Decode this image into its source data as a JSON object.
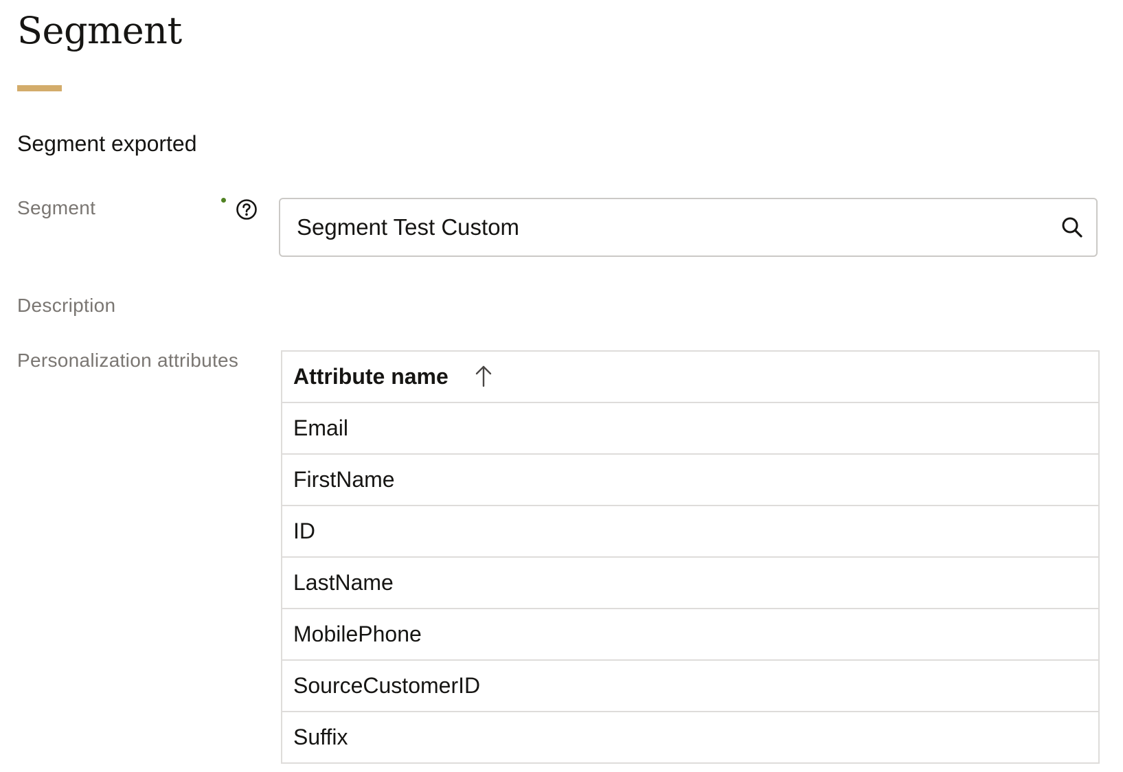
{
  "page": {
    "title": "Segment"
  },
  "section": {
    "heading": "Segment exported"
  },
  "form": {
    "segment_label": "Segment",
    "segment_value": "Segment Test Custom",
    "description_label": "Description",
    "attributes_label": "Personalization attributes"
  },
  "table": {
    "column_header": "Attribute name",
    "sort_direction": "ascending",
    "rows": [
      "Email",
      "FirstName",
      "ID",
      "LastName",
      "MobilePhone",
      "SourceCustomerID",
      "Suffix"
    ]
  },
  "icons": {
    "help": "help-icon",
    "search": "search-icon",
    "sort": "sort-ascending-icon"
  },
  "colors": {
    "accent": "#d3ac6b",
    "required_indicator": "#508223",
    "label_text": "#7a7672",
    "border": "#cbc9c6"
  }
}
